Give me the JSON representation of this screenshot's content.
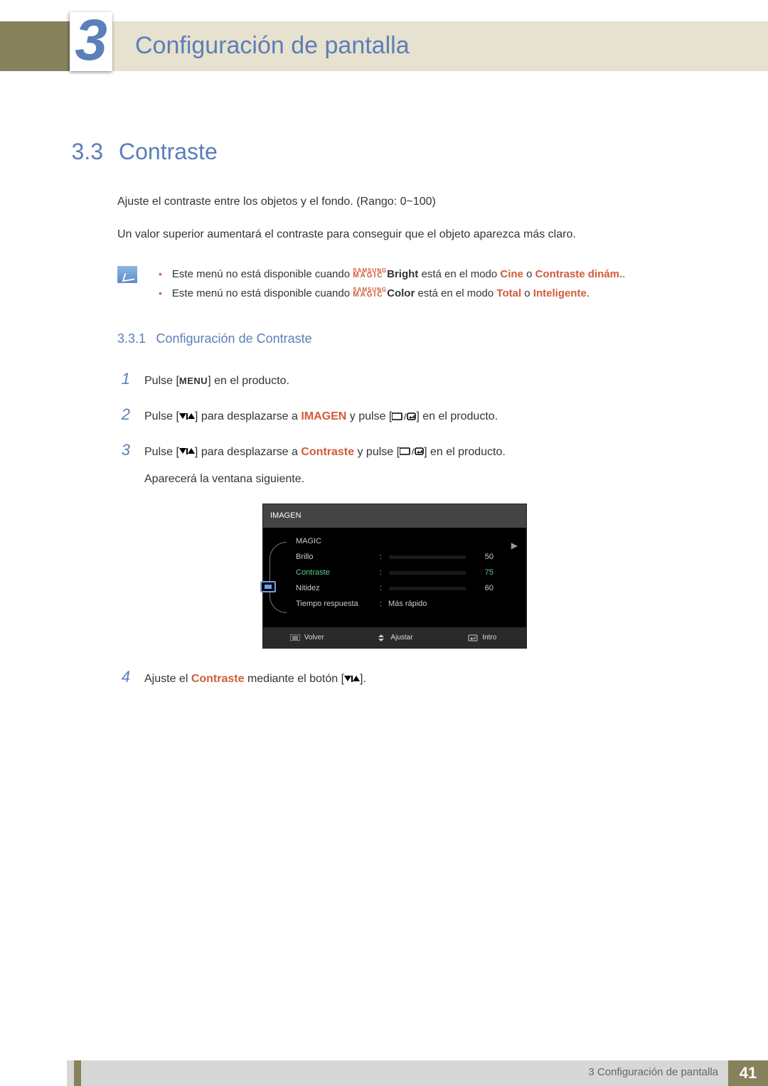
{
  "chapter": {
    "number": "3",
    "title": "Configuración de pantalla"
  },
  "section": {
    "number": "3.3",
    "title": "Contraste"
  },
  "intro": {
    "line1": "Ajuste el contraste entre los objetos y el fondo. (Rango: 0~100)",
    "line2": "Un valor superior aumentará el contraste para conseguir que el objeto aparezca más claro."
  },
  "notes": {
    "n1": {
      "pre": "Este menú no está disponible cuando ",
      "magic_small": "SAMSUNG",
      "magic_big": "MAGIC",
      "feature": "Bright",
      "mid": " está en el modo ",
      "mode1": "Cine",
      "or": " o ",
      "mode2": "Contraste dinám.",
      "end": "."
    },
    "n2": {
      "pre": "Este menú no está disponible cuando ",
      "magic_small": "SAMSUNG",
      "magic_big": "MAGIC",
      "feature": "Color",
      "mid": " está en el modo ",
      "mode1": "Total",
      "or": " o ",
      "mode2": "Inteligente",
      "end": "."
    }
  },
  "subsection": {
    "number": "3.3.1",
    "title": "Configuración de Contraste"
  },
  "steps": {
    "s1": {
      "pre": "Pulse [",
      "menu": "MENU",
      "post": "] en el producto."
    },
    "s2": {
      "pre": "Pulse [",
      "mid1": "] para desplazarse a ",
      "target": "IMAGEN",
      "mid2": " y pulse [",
      "post": "] en el producto."
    },
    "s3": {
      "pre": "Pulse [",
      "mid1": "] para desplazarse a ",
      "target": "Contraste",
      "mid2": " y pulse [",
      "post": "] en el producto.",
      "sub": "Aparecerá la ventana siguiente."
    },
    "s4": {
      "pre": "Ajuste el ",
      "target": "Contraste",
      "mid": " mediante el botón [",
      "post": "]."
    }
  },
  "osd": {
    "header": "IMAGEN",
    "rows": {
      "magic": {
        "label": "MAGIC"
      },
      "brillo": {
        "label": "Brillo",
        "value": "50",
        "pct": 50
      },
      "contraste": {
        "label": "Contraste",
        "value": "75",
        "pct": 75
      },
      "nitidez": {
        "label": "Nitidez",
        "value": "60",
        "pct": 60
      },
      "tiempo": {
        "label": "Tiempo respuesta",
        "text": "Más rápido"
      }
    },
    "footer": {
      "volver": "Volver",
      "ajustar": "Ajustar",
      "intro": "Intro"
    }
  },
  "footer": {
    "text": "3 Configuración de pantalla",
    "page": "41"
  }
}
